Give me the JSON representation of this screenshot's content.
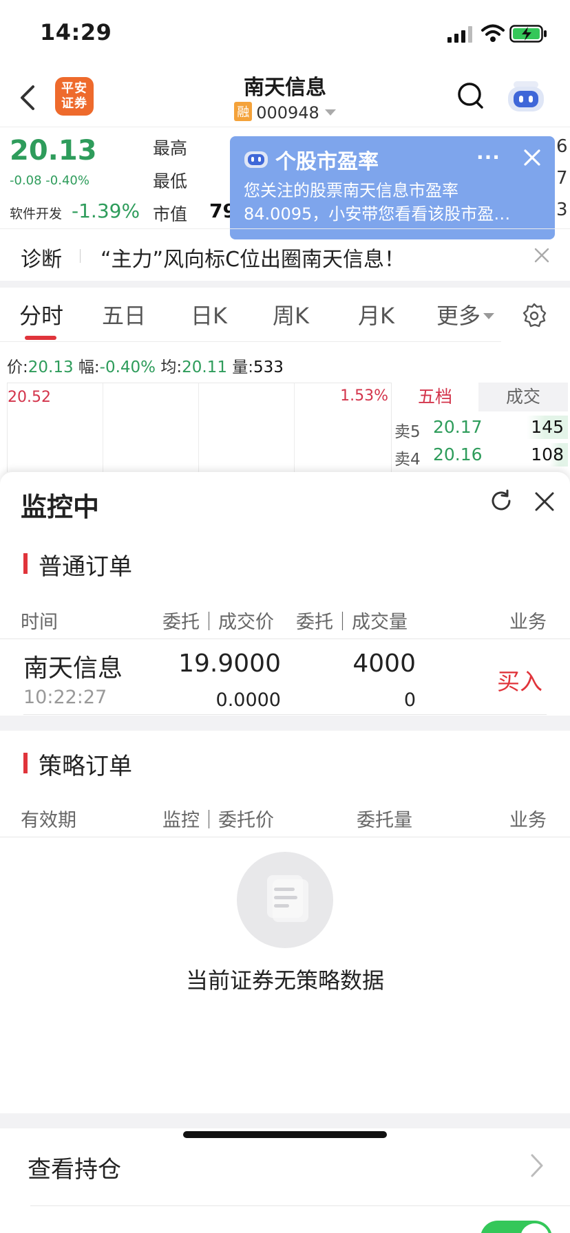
{
  "status": {
    "time": "14:29"
  },
  "nav": {
    "logo_line1": "平安",
    "logo_line2": "证券",
    "stock_name": "南天信息",
    "margin_badge": "融",
    "stock_code": "000948"
  },
  "quote": {
    "price": "20.13",
    "change": "-0.08 -0.40%",
    "sector": "软件开发",
    "sector_change": "-1.39%",
    "labels": {
      "high": "最高",
      "low": "最低",
      "cap": "市值"
    },
    "cap_fragment": "79",
    "right_fragments": [
      "6",
      "7",
      "3"
    ]
  },
  "popup": {
    "title": "个股市盈率",
    "more": "···",
    "line1": "您关注的股票南天信息市盈率",
    "line2": "84.0095，小安带您看看该股市盈…"
  },
  "diagnosis": {
    "label": "诊断",
    "text": "“主力”风向标C位出圈南天信息！"
  },
  "tabs": [
    "分时",
    "五日",
    "日K",
    "周K",
    "月K",
    "更多"
  ],
  "info": {
    "price_label": "价:",
    "price": "20.13",
    "range_label": "幅:",
    "range": "-0.40%",
    "avg_label": "均:",
    "avg": "20.11",
    "vol_label": "量:",
    "vol": "533"
  },
  "chart": {
    "high": "20.52",
    "high_pct": "1.53%"
  },
  "order_book": {
    "tab_levels": "五档",
    "tab_trades": "成交",
    "rows": [
      {
        "label": "卖5",
        "price": "20.17",
        "qty": "145"
      },
      {
        "label": "卖4",
        "price": "20.16",
        "qty": "108"
      }
    ]
  },
  "sheet": {
    "title": "监控中",
    "normal": {
      "title": "普通订单",
      "headers": {
        "time": "时间",
        "price": "委托｜成交价",
        "qty": "委托｜成交量",
        "side": "业务"
      },
      "order": {
        "name": "南天信息",
        "time": "10:22:27",
        "order_price": "19.9000",
        "deal_price": "0.0000",
        "order_qty": "4000",
        "deal_qty": "0",
        "side": "买入"
      }
    },
    "strategy": {
      "title": "策略订单",
      "headers": {
        "validity": "有效期",
        "monitor_price": "监控｜委托价",
        "qty": "委托量",
        "side": "业务"
      },
      "empty": "当前证券无策略数据"
    },
    "holdings": "查看持仓"
  },
  "colors": {
    "up": "#d3344b",
    "down": "#2e9c5b",
    "accent": "#e0343b",
    "popup": "#7ea5ec"
  }
}
